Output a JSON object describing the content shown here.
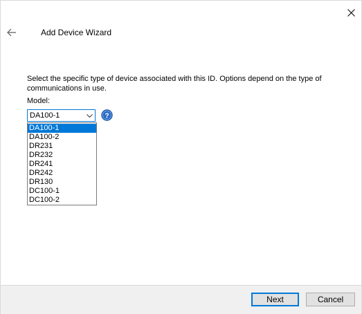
{
  "wizard": {
    "title": "Add Device Wizard",
    "instructions": "Select the specific type of device associated with this ID. Options depend on the type of communications in use.",
    "model_label": "Model:"
  },
  "model_combo": {
    "selected": "DA100-1",
    "options": [
      "DA100-1",
      "DA100-2",
      "DR231",
      "DR232",
      "DR241",
      "DR242",
      "DR130",
      "DC100-1",
      "DC100-2"
    ],
    "highlighted_index": 0
  },
  "footer": {
    "next_label": "Next",
    "cancel_label": "Cancel"
  },
  "colors": {
    "accent": "#0078d7",
    "footer_bg": "#f0f0f0",
    "help_icon": "#2b6cc4"
  },
  "icons": {
    "close": "close-icon",
    "back": "back-arrow-icon",
    "help": "help-icon",
    "dropdown": "chevron-down-icon"
  }
}
